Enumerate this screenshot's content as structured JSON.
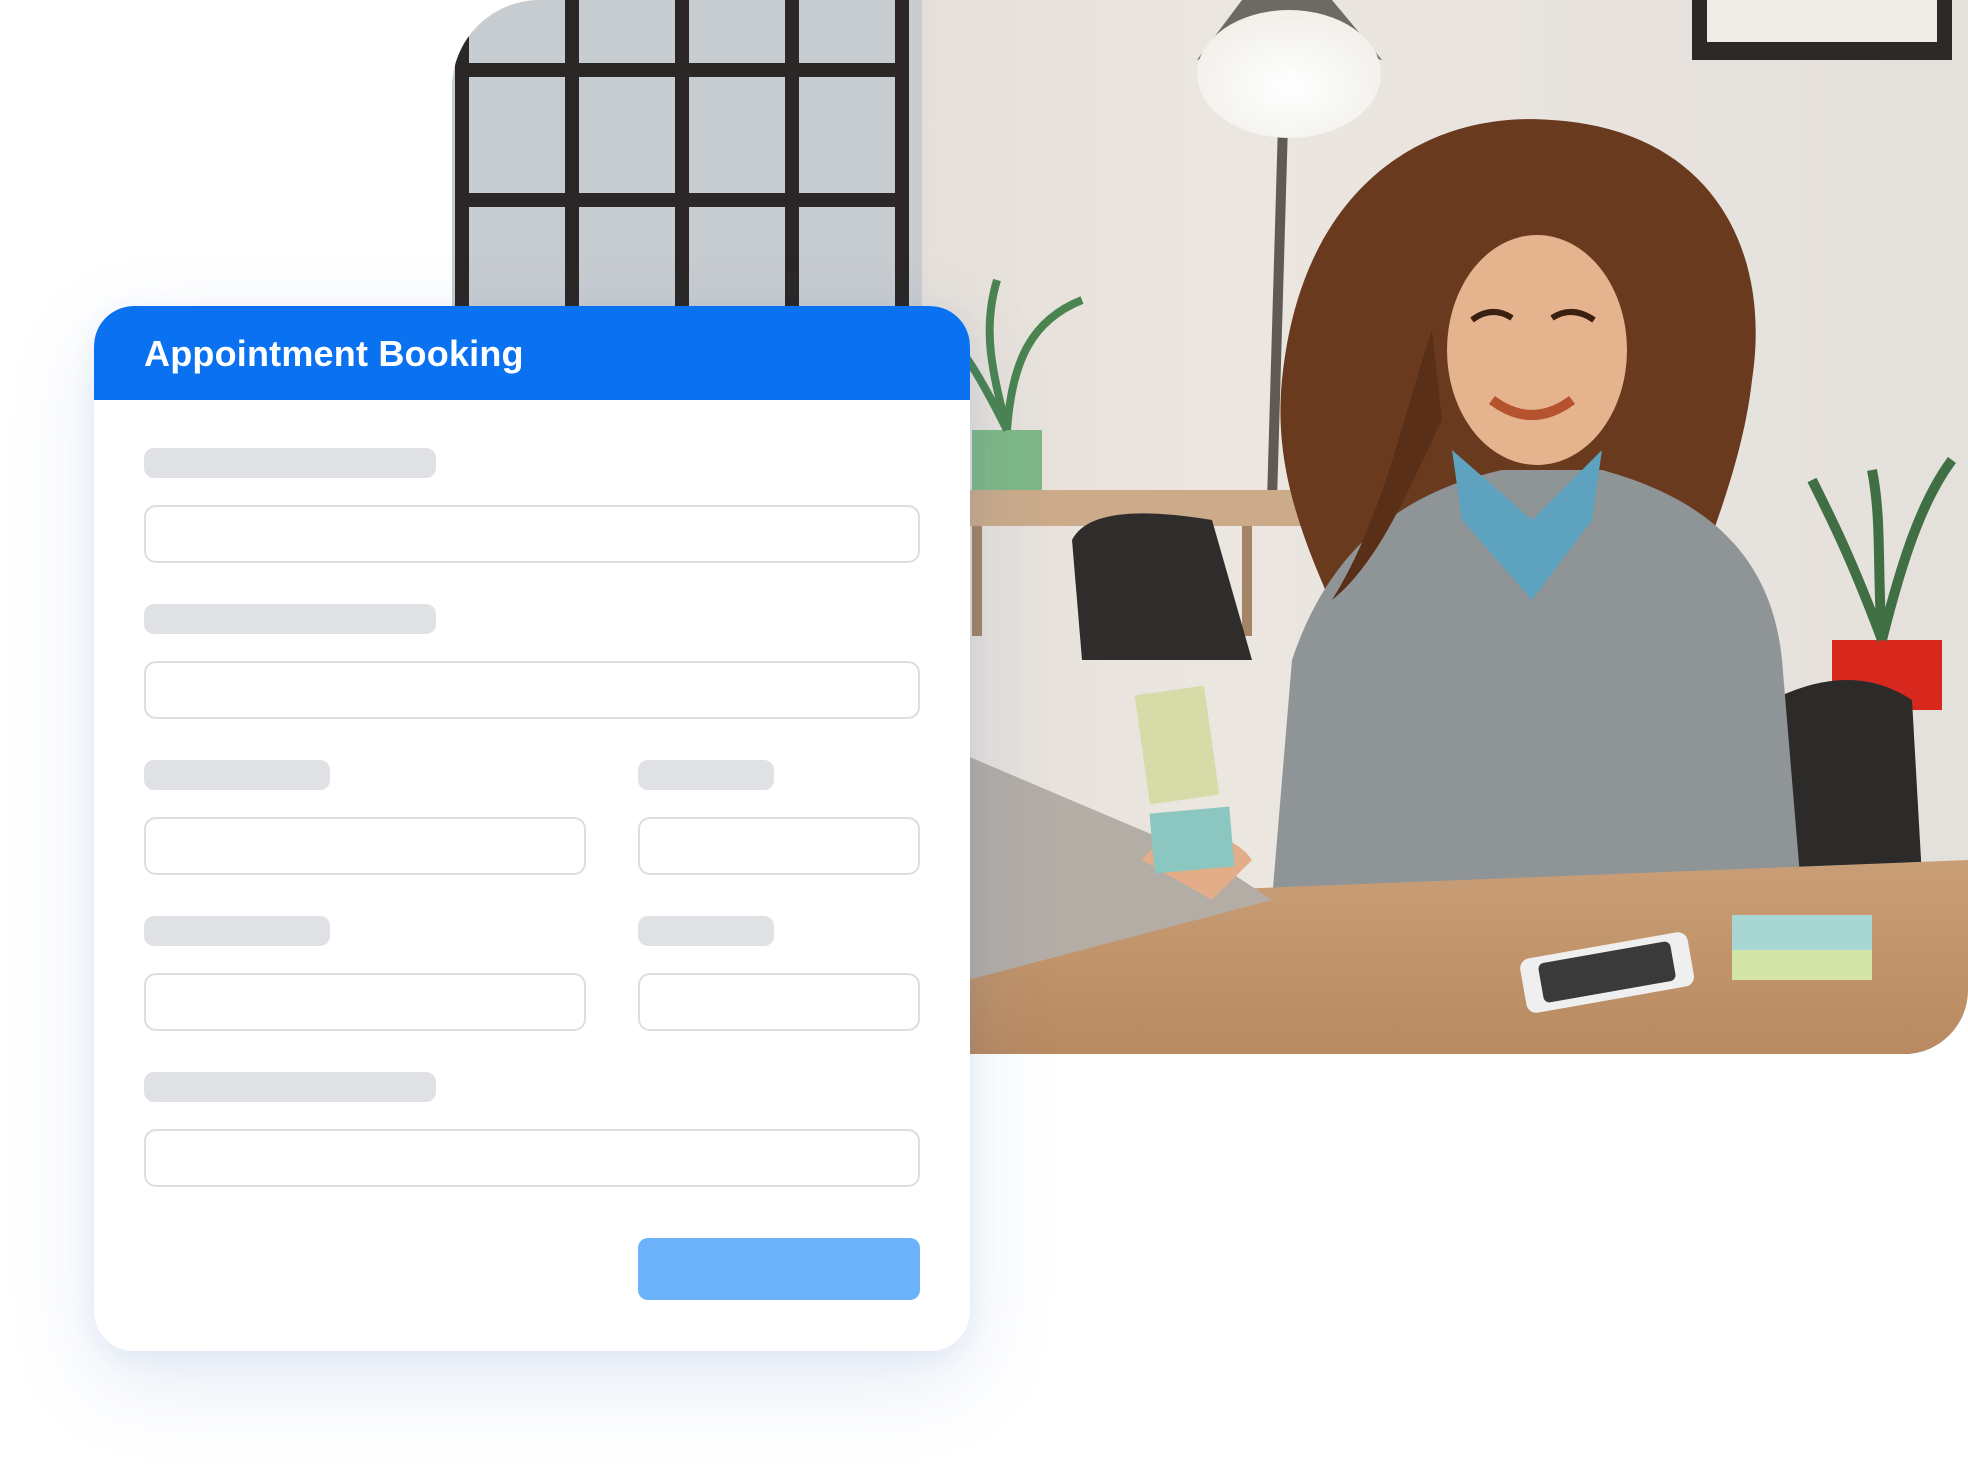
{
  "form": {
    "title": "Appointment Booking",
    "header_color": "#0a72f0",
    "submit_color": "#6cb2fb",
    "fields": [
      {
        "label": "",
        "value": ""
      },
      {
        "label": "",
        "value": ""
      },
      {
        "label": "",
        "value": ""
      },
      {
        "label": "",
        "value": ""
      },
      {
        "label": "",
        "value": ""
      },
      {
        "label": "",
        "value": ""
      },
      {
        "label": "",
        "value": ""
      }
    ],
    "submit_label": ""
  },
  "photo": {
    "subject": "photo-woman-laptop"
  }
}
